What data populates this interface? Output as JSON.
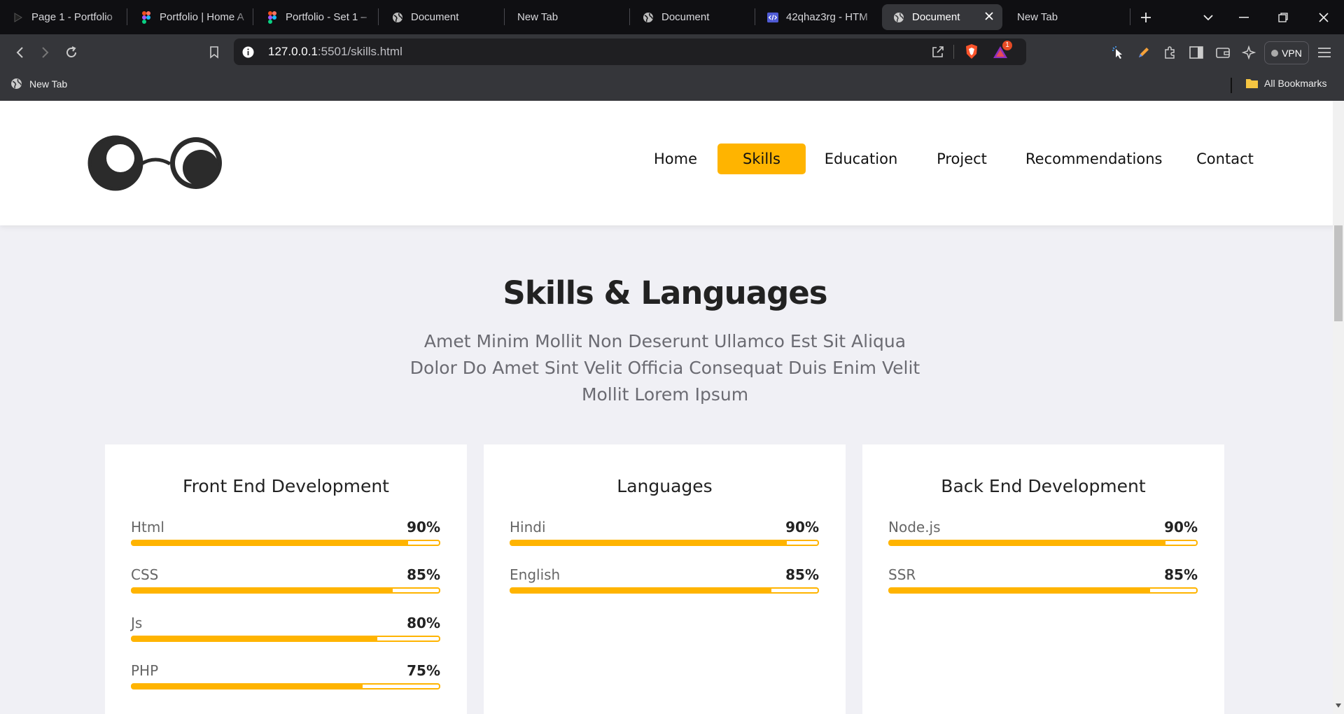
{
  "browser": {
    "tabs": [
      {
        "title": "Page 1 - Portfolio",
        "icon": "play-icon",
        "active": false
      },
      {
        "title": "Portfolio | Home A",
        "icon": "figma-icon",
        "active": false
      },
      {
        "title": "Portfolio - Set 1 –",
        "icon": "figma-icon",
        "active": false
      },
      {
        "title": "Document",
        "icon": "globe-icon",
        "active": false
      },
      {
        "title": "New Tab",
        "icon": "none",
        "active": false
      },
      {
        "title": "Document",
        "icon": "globe-icon",
        "active": false
      },
      {
        "title": "42qhaz3rg - HTM",
        "icon": "code-icon",
        "active": false
      },
      {
        "title": "Document",
        "icon": "globe-icon",
        "active": true
      },
      {
        "title": "New Tab",
        "icon": "none",
        "active": false
      }
    ],
    "url_host": "127.0.0.1",
    "url_path": ":5501/skills.html",
    "vpn_label": "VPN",
    "notification_count": "1",
    "bookmark_new_tab": "New Tab",
    "all_bookmarks": "All Bookmarks"
  },
  "nav": {
    "items": [
      "Home",
      "Skills",
      "Education",
      "Project",
      "Recommendations",
      "Contact"
    ],
    "active": "Skills"
  },
  "main": {
    "heading": "Skills & Languages",
    "subtext": "Amet Minim Mollit Non Deserunt Ullamco Est Sit Aliqua Dolor Do Amet Sint Velit Officia Consequat Duis Enim Velit Mollit Lorem Ipsum"
  },
  "cards": [
    {
      "title": "Front End Development",
      "skills": [
        {
          "name": "Html",
          "percent": "90%",
          "level": 0.9
        },
        {
          "name": "CSS",
          "percent": "85%",
          "level": 0.85
        },
        {
          "name": "Js",
          "percent": "80%",
          "level": 0.8
        },
        {
          "name": "PHP",
          "percent": "75%",
          "level": 0.75
        }
      ]
    },
    {
      "title": "Languages",
      "skills": [
        {
          "name": "Hindi",
          "percent": "90%",
          "level": 0.9
        },
        {
          "name": "English",
          "percent": "85%",
          "level": 0.85
        }
      ]
    },
    {
      "title": "Back End Development",
      "skills": [
        {
          "name": "Node.js",
          "percent": "90%",
          "level": 0.9
        },
        {
          "name": "SSR",
          "percent": "85%",
          "level": 0.85
        }
      ]
    }
  ],
  "colors": {
    "accent": "#ffb400",
    "page_bg": "#f0f0f5"
  }
}
